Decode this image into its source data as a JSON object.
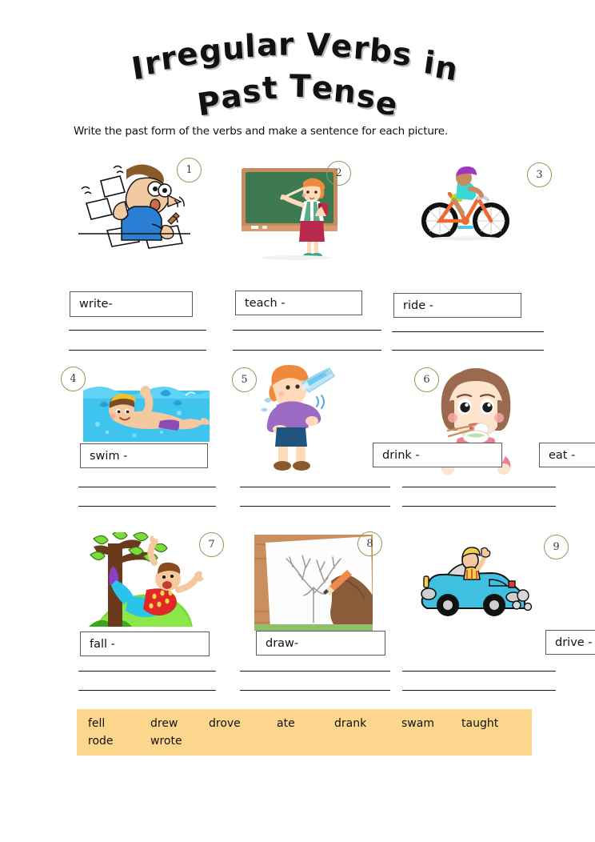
{
  "page": {
    "title_line1": "Irregular Verbs in",
    "title_line2": "Past Tense",
    "instruction": "Write the past form of the verbs and make a sentence for each picture.",
    "background": "#ffffff",
    "badge_color": "#84a05a",
    "wordbank_bg": "#fbd68c"
  },
  "items": [
    {
      "number": "1",
      "prompt": "write-",
      "picture": "man-writing-papers-icon"
    },
    {
      "number": "2",
      "prompt": "teach -",
      "picture": "teacher-chalkboard-icon"
    },
    {
      "number": "3",
      "prompt": "ride -",
      "picture": "boy-riding-bicycle-icon"
    },
    {
      "number": "4",
      "prompt": "swim -",
      "picture": "boy-swimming-icon"
    },
    {
      "number": "5",
      "prompt": "drink -",
      "picture": "boy-drinking-water-icon"
    },
    {
      "number": "6",
      "prompt": "eat -",
      "picture": "girl-eating-icon"
    },
    {
      "number": "7",
      "prompt": "fall -",
      "picture": "boy-falling-from-tree-icon"
    },
    {
      "number": "8",
      "prompt": "draw-",
      "picture": "hand-drawing-tree-icon"
    },
    {
      "number": "9",
      "prompt": "drive -",
      "picture": "man-driving-car-icon"
    }
  ],
  "word_bank": {
    "row1": [
      "fell",
      "drew",
      "drove",
      "ate",
      "drank",
      "swam",
      "taught"
    ],
    "row2": [
      "rode",
      "wrote"
    ]
  }
}
